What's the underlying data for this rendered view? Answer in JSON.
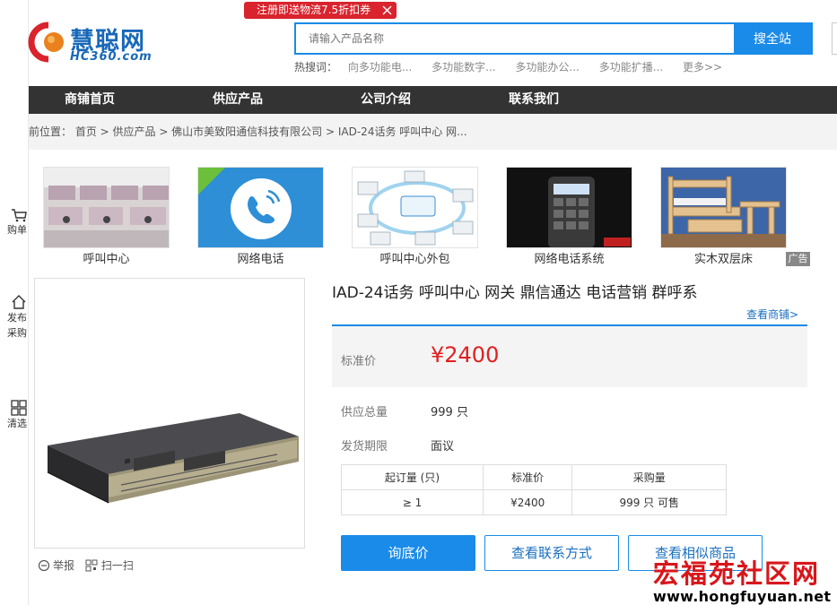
{
  "promo": {
    "text": "注册即送物流7.5折扣券"
  },
  "logo": {
    "cn": "慧聪网",
    "en": "HC360.com"
  },
  "left_bar": {
    "cart": "购单",
    "publish_line1": "发布",
    "publish_line2": "采购",
    "filter": "清选"
  },
  "search": {
    "placeholder": "请输入产品名称",
    "button": "搜全站"
  },
  "hot_search": {
    "label": "热搜词：",
    "terms": [
      "向多功能电...",
      "多功能数字...",
      "多功能办公...",
      "多功能扩播...",
      "更多>>"
    ]
  },
  "nav": {
    "items": [
      "商铺首页",
      "供应产品",
      "公司介绍",
      "联系我们"
    ]
  },
  "breadcrumb": {
    "text": "前位置： 首页 > 供应产品 > 佛山市美致阳通信科技有限公司 > IAD-24话务 呼叫中心 网..."
  },
  "recommend": {
    "items": [
      "呼叫中心",
      "网络电话",
      "呼叫中心外包",
      "网络电话系统",
      "实木双层床"
    ],
    "ad_tag": "广告"
  },
  "product": {
    "title": "IAD-24话务 呼叫中心 网关 鼎信通达 电话营销 群呼系",
    "shop_link": "查看商铺>",
    "price_label": "标准价",
    "price": "¥2400",
    "supply_label": "供应总量",
    "supply_value": "999 只",
    "ship_label": "发货期限",
    "ship_value": "面议"
  },
  "tiers": {
    "headers": [
      "起订量 (只)",
      "标准价",
      "采购量"
    ],
    "row": [
      "≥ 1",
      "¥2400",
      "999 只 可售"
    ]
  },
  "tools": {
    "report": "举报",
    "scan": "扫一扫"
  },
  "buttons": {
    "inquiry": "询底价",
    "contact": "查看联系方式",
    "similar": "查看相似商品"
  },
  "watermark": {
    "cn": "宏福苑社区网",
    "url": "www.hongfuyuan.net"
  },
  "colors": {
    "accent": "#1a8be8",
    "price": "#e02020",
    "nav_bg": "#333333",
    "promo": "#d9232d"
  }
}
